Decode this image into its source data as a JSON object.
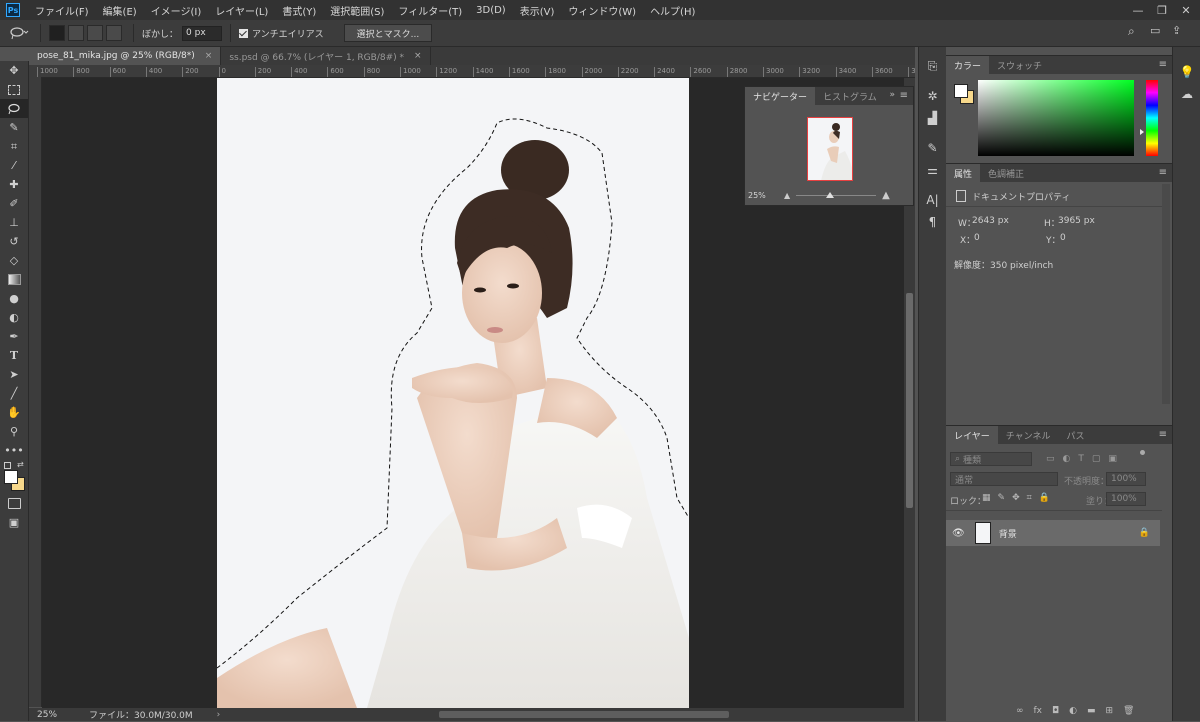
{
  "app": {
    "logo": "Ps"
  },
  "menu": [
    "ファイル(F)",
    "編集(E)",
    "イメージ(I)",
    "レイヤー(L)",
    "書式(Y)",
    "選択範囲(S)",
    "フィルター(T)",
    "3D(D)",
    "表示(V)",
    "ウィンドウ(W)",
    "ヘルプ(H)"
  ],
  "window_controls": {
    "minimize": "—",
    "restore": "❐",
    "close": "✕"
  },
  "options": {
    "feather_label": "ぼかし：",
    "feather_value": "0 px",
    "antialias_label": "アンチエイリアス",
    "mask_button": "選択とマスク..."
  },
  "tabs": [
    {
      "label": "pose_81_mika.jpg @ 25% (RGB/8*)",
      "close": "×"
    },
    {
      "label": "ss.psd @ 66.7% (レイヤー 1, RGB/8#) *",
      "close": "×"
    }
  ],
  "ruler_ticks": [
    "1000",
    "800",
    "600",
    "400",
    "200",
    "0",
    "200",
    "400",
    "600",
    "800",
    "1000",
    "1200",
    "1400",
    "1600",
    "1800",
    "2000",
    "2200",
    "2400",
    "2600",
    "2800",
    "3000",
    "3200",
    "3400",
    "3600",
    "38"
  ],
  "navigator": {
    "tabs": [
      "ナビゲーター",
      "ヒストグラム"
    ],
    "zoom": "25%",
    "zoom_fraction": 0.42
  },
  "color_panel": {
    "tabs": [
      "カラー",
      "スウォッチ"
    ]
  },
  "properties": {
    "tabs": [
      "属性",
      "色調補正"
    ],
    "title": "ドキュメントプロパティ",
    "w_label": "W：",
    "w_value": "2643 px",
    "h_label": "H：",
    "h_value": "3965 px",
    "x_label": "X：",
    "x_value": "0",
    "y_label": "Y：",
    "y_value": "0",
    "resolution": "解像度：350 pixel/inch"
  },
  "layers": {
    "tabs": [
      "レイヤー",
      "チャンネル",
      "パス"
    ],
    "filter_placeholder": "種類",
    "blend_mode": "通常",
    "opacity_label": "不透明度：",
    "opacity_value": "100%",
    "lock_label": "ロック：",
    "fill_label": "塗り：",
    "fill_value": "100%",
    "items": [
      {
        "name": "背景"
      }
    ]
  },
  "status": {
    "zoom": "25%",
    "file_info": "ファイル：30.0M/30.0M",
    "arrow": "›"
  },
  "colors": {
    "foreground": "#ffffff",
    "background": "#f7d88b",
    "accent": "#31a8ff"
  }
}
